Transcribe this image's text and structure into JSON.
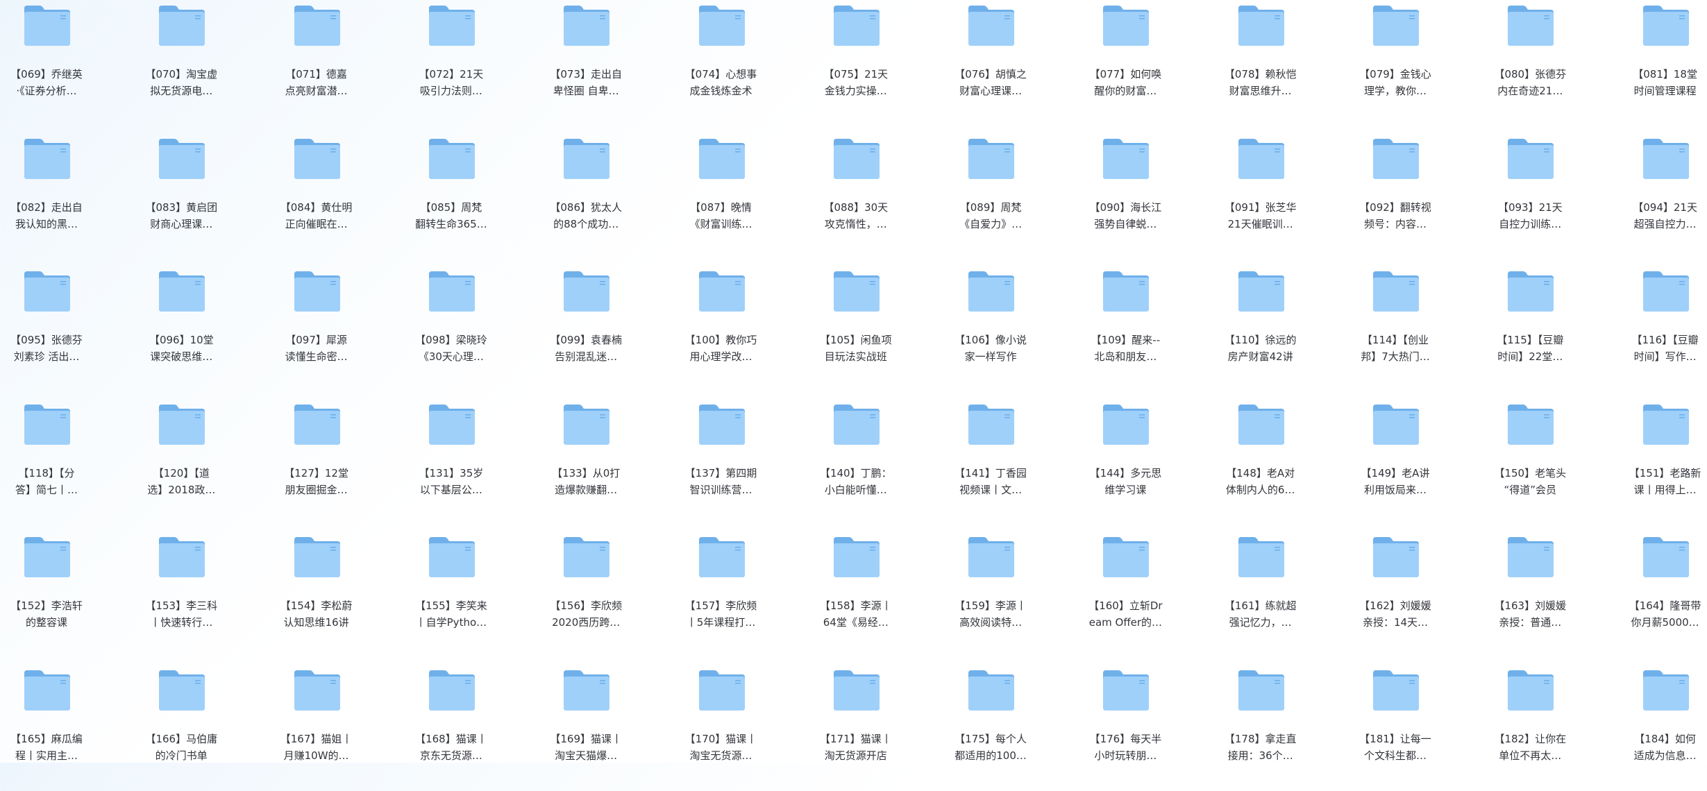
{
  "colors": {
    "folder_back": "#6fb0ea",
    "folder_front": "#9fd0fa",
    "folder_tab": "#5aa2e3",
    "label_text": "#33353b",
    "background": "#ffffff"
  },
  "folder_icon": "folder-icon",
  "folders": [
    {
      "line1": "【069】乔继英",
      "line2": "·《证券分析…"
    },
    {
      "line1": "【070】淘宝虚",
      "line2": "拟无货源电…"
    },
    {
      "line1": "【071】德嘉",
      "line2": "点亮财富潜…"
    },
    {
      "line1": "【072】21天",
      "line2": "吸引力法则…"
    },
    {
      "line1": "【073】走出自",
      "line2": "卑怪圈 自卑…"
    },
    {
      "line1": "【074】心想事",
      "line2": "成金钱炼金术"
    },
    {
      "line1": "【075】21天",
      "line2": "金钱力实操…"
    },
    {
      "line1": "【076】胡慎之",
      "line2": "财富心理课…"
    },
    {
      "line1": "【077】如何唤",
      "line2": "醒你的财富…"
    },
    {
      "line1": "【078】赖秋恺",
      "line2": "财富思维升…"
    },
    {
      "line1": "【079】金钱心",
      "line2": "理学，教你…"
    },
    {
      "line1": "【080】张德芬",
      "line2": "内在奇迹21…"
    },
    {
      "line1": "【081】18堂",
      "line2": "时间管理课程"
    },
    {
      "line1": "【082】走出自",
      "line2": "我认知的黑…"
    },
    {
      "line1": "【083】黄启团",
      "line2": "财商心理课…"
    },
    {
      "line1": "【084】黄仕明",
      "line2": "正向催眠在…"
    },
    {
      "line1": "【085】周梵",
      "line2": "翻转生命365…"
    },
    {
      "line1": "【086】犹太人",
      "line2": "的88个成功…"
    },
    {
      "line1": "【087】晚情",
      "line2": "《财富训练…"
    },
    {
      "line1": "【088】30天",
      "line2": "攻克惰性，…"
    },
    {
      "line1": "【089】周梵",
      "line2": "《自爱力》…"
    },
    {
      "line1": "【090】海长江",
      "line2": "强势自律蜕…"
    },
    {
      "line1": "【091】张芝华",
      "line2": "21天催眠训…"
    },
    {
      "line1": "【092】翻转视",
      "line2": "频号：内容…"
    },
    {
      "line1": "【093】21天",
      "line2": "自控力训练…"
    },
    {
      "line1": "【094】21天",
      "line2": "超强自控力…"
    },
    {
      "line1": "【095】张德芬",
      "line2": "刘素珍 活出…"
    },
    {
      "line1": "【096】10堂",
      "line2": "课突破思维…"
    },
    {
      "line1": "【097】犀源",
      "line2": "读懂生命密…"
    },
    {
      "line1": "【098】梁晓玲",
      "line2": "《30天心理…"
    },
    {
      "line1": "【099】袁春楠",
      "line2": "告别混乱迷…"
    },
    {
      "line1": "【100】教你巧",
      "line2": "用心理学改…"
    },
    {
      "line1": "【105】闲鱼项",
      "line2": "目玩法实战班"
    },
    {
      "line1": "【106】像小说",
      "line2": "家一样写作"
    },
    {
      "line1": "【109】醒来--",
      "line2": "北岛和朋友…"
    },
    {
      "line1": "【110】徐远的",
      "line2": "房产财富42讲"
    },
    {
      "line1": "【114】【创业",
      "line2": "邦】7大热门…"
    },
    {
      "line1": "【115】【豆瓣",
      "line2": "时间】22堂…"
    },
    {
      "line1": "【116】【豆瓣",
      "line2": "时间】写作…"
    },
    {
      "line1": "【118】【分",
      "line2": "答】简七丨…"
    },
    {
      "line1": "【120】【道",
      "line2": "选】2018政…"
    },
    {
      "line1": "【127】12堂",
      "line2": "朋友圈掘金…"
    },
    {
      "line1": "【131】35岁",
      "line2": "以下基层公…"
    },
    {
      "line1": "【133】从0打",
      "line2": "造爆款赚翻…"
    },
    {
      "line1": "【137】第四期",
      "line2": "智识训练营…"
    },
    {
      "line1": "【140】丁鹏：",
      "line2": "小白能听懂…"
    },
    {
      "line1": "【141】丁香园",
      "line2": "视频课丨文…"
    },
    {
      "line1": "【144】多元思",
      "line2": "维学习课"
    },
    {
      "line1": "【148】老A对",
      "line2": "体制内人的6…"
    },
    {
      "line1": "【149】老A讲",
      "line2": "利用饭局来…"
    },
    {
      "line1": "【150】老笔头",
      "line2": "“得道”会员"
    },
    {
      "line1": "【151】老路新",
      "line2": "课丨用得上…"
    },
    {
      "line1": "【152】李浩轩",
      "line2": "的整容课"
    },
    {
      "line1": "【153】李三科",
      "line2": "丨快速转行…"
    },
    {
      "line1": "【154】李松蔚",
      "line2": "认知思维16讲"
    },
    {
      "line1": "【155】李笑来",
      "line2": "丨自学Pytho…"
    },
    {
      "line1": "【156】李欣频",
      "line2": "2020西历跨…"
    },
    {
      "line1": "【157】李欣频",
      "line2": "丨5年课程打…"
    },
    {
      "line1": "【158】李源丨",
      "line2": "64堂《易经…"
    },
    {
      "line1": "【159】李源丨",
      "line2": "高效阅读特…"
    },
    {
      "line1": "【160】立斩Dr",
      "line2": "eam Offer的…"
    },
    {
      "line1": "【161】练就超",
      "line2": "强记忆力，…"
    },
    {
      "line1": "【162】刘媛媛",
      "line2": "亲授：14天…"
    },
    {
      "line1": "【163】刘媛媛",
      "line2": "亲授：普通…"
    },
    {
      "line1": "【164】隆哥带",
      "line2": "你月薪5000…"
    },
    {
      "line1": "【165】麻瓜编",
      "line2": "程丨实用主…"
    },
    {
      "line1": "【166】马伯庸",
      "line2": "的冷门书单"
    },
    {
      "line1": "【167】猫姐丨",
      "line2": "月赚10W的…"
    },
    {
      "line1": "【168】猫课丨",
      "line2": "京东无货源…"
    },
    {
      "line1": "【169】猫课丨",
      "line2": "淘宝天猫爆…"
    },
    {
      "line1": "【170】猫课丨",
      "line2": "淘宝无货源…"
    },
    {
      "line1": "【171】猫课丨",
      "line2": "淘无货源开店"
    },
    {
      "line1": "【175】每个人",
      "line2": "都适用的100…"
    },
    {
      "line1": "【176】每天半",
      "line2": "小时玩转朋…"
    },
    {
      "line1": "【178】拿走直",
      "line2": "接用：36个…"
    },
    {
      "line1": "【181】让每一",
      "line2": "个文科生都…"
    },
    {
      "line1": "【182】让你在",
      "line2": "单位不再太…"
    },
    {
      "line1": "【184】如何",
      "line2": "适成为信息…"
    }
  ]
}
